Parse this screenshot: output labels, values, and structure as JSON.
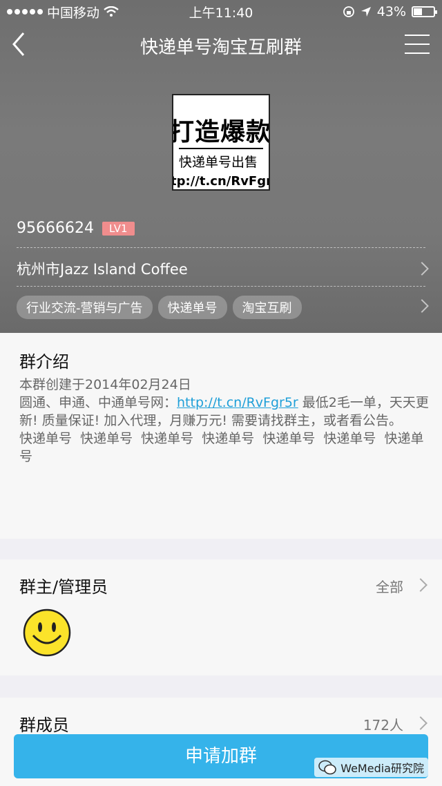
{
  "status_bar": {
    "carrier": "中国移动",
    "time": "上午11:40",
    "battery": "43%",
    "battery_level": 0.43
  },
  "nav": {
    "title": "快递单号淘宝互刷群"
  },
  "group_avatar": {
    "line1": "打造爆款",
    "line2": "快递单号出售",
    "line3": "tp://t.cn/RvFgr"
  },
  "group": {
    "id": "95666624",
    "level": "LV1",
    "location": "杭州市Jazz Island Coffee",
    "tags": [
      "行业交流-营销与广告",
      "快递单号",
      "淘宝互刷"
    ]
  },
  "intro": {
    "title": "群介绍",
    "created": "本群创建于2014年02月24日",
    "line_prefix": "圆通、申通、中通单号网：",
    "link": "http://t.cn/RvFgr5r",
    "line_suffix": " 最低2毛一单，天天更新! 质量保证! 加入代理，月赚万元! 需要请找群主，或者看公告。",
    "keywords": "快递单号  快递单号  快递单号  快递单号  快递单号  快递单号  快递单号"
  },
  "admins": {
    "title": "群主/管理员",
    "all_label": "全部"
  },
  "members": {
    "title": "群成员",
    "count": "172人"
  },
  "join_button": "申请加群",
  "watermark": "WeMedia研究院"
}
